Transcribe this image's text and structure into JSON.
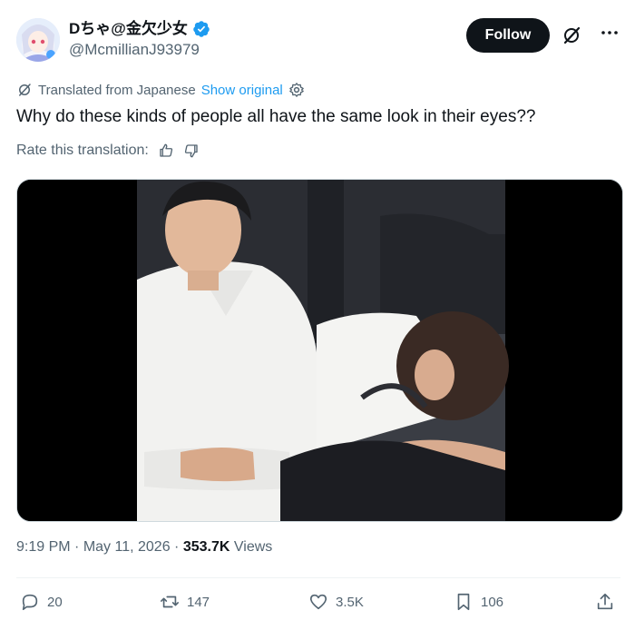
{
  "author": {
    "display_name": "Dちゃ@金欠少女",
    "handle": "@McmillianJ93979",
    "verified": true
  },
  "header": {
    "follow_label": "Follow",
    "grok_icon": "grok-icon",
    "more_icon": "more-icon"
  },
  "translation": {
    "label": "Translated from Japanese",
    "show_original": "Show original",
    "settings_icon": "gear-icon"
  },
  "tweet": {
    "text": "Why do these kinds of people all have the same look in their eyes??"
  },
  "rate": {
    "label": "Rate this translation:",
    "icons": [
      "thumbs-up-icon",
      "thumbs-down-icon"
    ]
  },
  "media": {
    "description_icon": "photo-media"
  },
  "meta": {
    "time": "9:19 PM",
    "sep1": "·",
    "date": "May 11, 2026",
    "sep2": "·",
    "views": "353.7K",
    "views_label": "Views"
  },
  "actions": {
    "replies": "20",
    "reposts": "147",
    "likes": "3.5K",
    "bookmarks": "106"
  },
  "colors": {
    "accent": "#1d9bf0",
    "text": "#0f1419",
    "muted": "#536471",
    "verified": "#1d9bf0"
  }
}
